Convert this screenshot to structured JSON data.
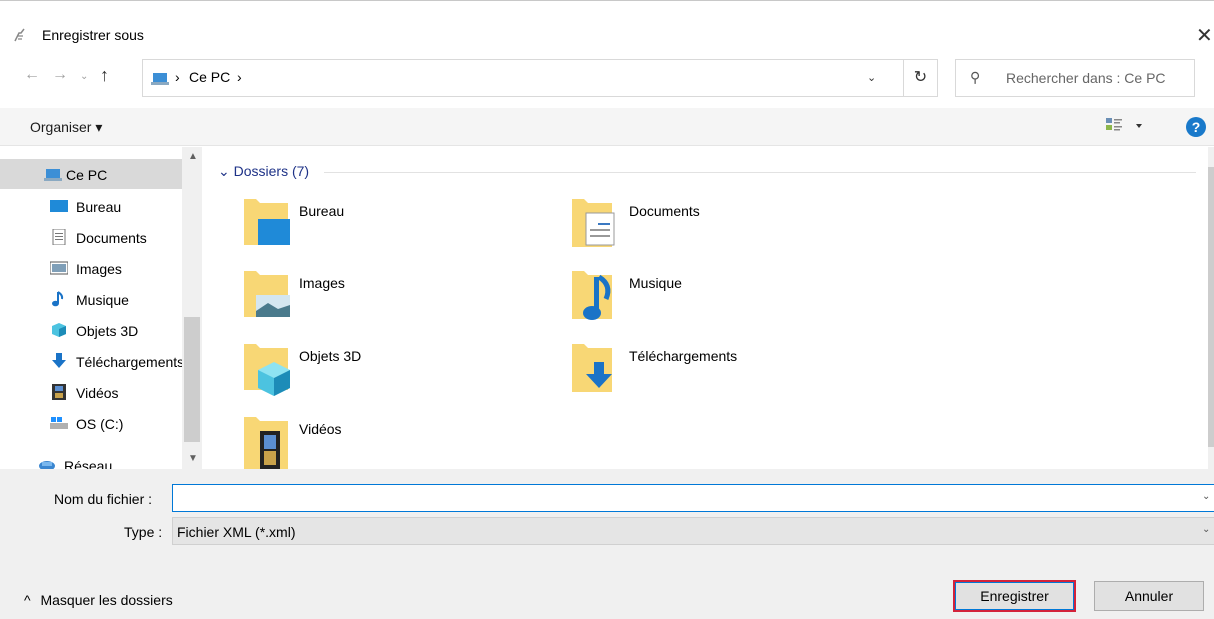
{
  "window": {
    "title": "Enregistrer sous",
    "close_glyph": "✕"
  },
  "nav": {
    "back_glyph": "←",
    "forward_glyph": "→",
    "recent_glyph": "⌄",
    "up_glyph": "↑",
    "breadcrumb": [
      "Ce PC"
    ],
    "separator": "›",
    "dropdown_glyph": "⌄",
    "refresh_glyph": "↻",
    "search_placeholder": "Rechercher dans : Ce PC"
  },
  "toolbar": {
    "organise_label": "Organiser ▾",
    "help_label": "?"
  },
  "sidebar": {
    "items": [
      {
        "label": "Ce PC",
        "icon": "computer-icon"
      },
      {
        "label": "Bureau",
        "icon": "desktop-icon"
      },
      {
        "label": "Documents",
        "icon": "documents-icon"
      },
      {
        "label": "Images",
        "icon": "images-icon"
      },
      {
        "label": "Musique",
        "icon": "music-icon"
      },
      {
        "label": "Objets 3D",
        "icon": "3d-objects-icon"
      },
      {
        "label": "Téléchargements",
        "icon": "downloads-icon"
      },
      {
        "label": "Vidéos",
        "icon": "videos-icon"
      },
      {
        "label": "OS (C:)",
        "icon": "drive-icon"
      },
      {
        "label": "Réseau",
        "icon": "network-icon"
      }
    ]
  },
  "content": {
    "group_header": "Dossiers (7)",
    "folders": [
      {
        "name": "Bureau",
        "icon": "desktop-folder-icon"
      },
      {
        "name": "Documents",
        "icon": "documents-folder-icon"
      },
      {
        "name": "Images",
        "icon": "images-folder-icon"
      },
      {
        "name": "Musique",
        "icon": "music-folder-icon"
      },
      {
        "name": "Objets 3D",
        "icon": "3d-objects-folder-icon"
      },
      {
        "name": "Téléchargements",
        "icon": "downloads-folder-icon"
      },
      {
        "name": "Vidéos",
        "icon": "videos-folder-icon"
      }
    ]
  },
  "form": {
    "filename_label": "Nom du fichier :",
    "filename_value": "",
    "type_label": "Type :",
    "type_value": "Fichier XML (*.xml)"
  },
  "footer": {
    "hide_folders_label": "Masquer les dossiers",
    "save_label": "Enregistrer",
    "cancel_label": "Annuler"
  },
  "colors": {
    "accent": "#0078d7",
    "highlight_border": "#d3223a",
    "folder": "#f8d775",
    "group_header": "#1e3287"
  }
}
